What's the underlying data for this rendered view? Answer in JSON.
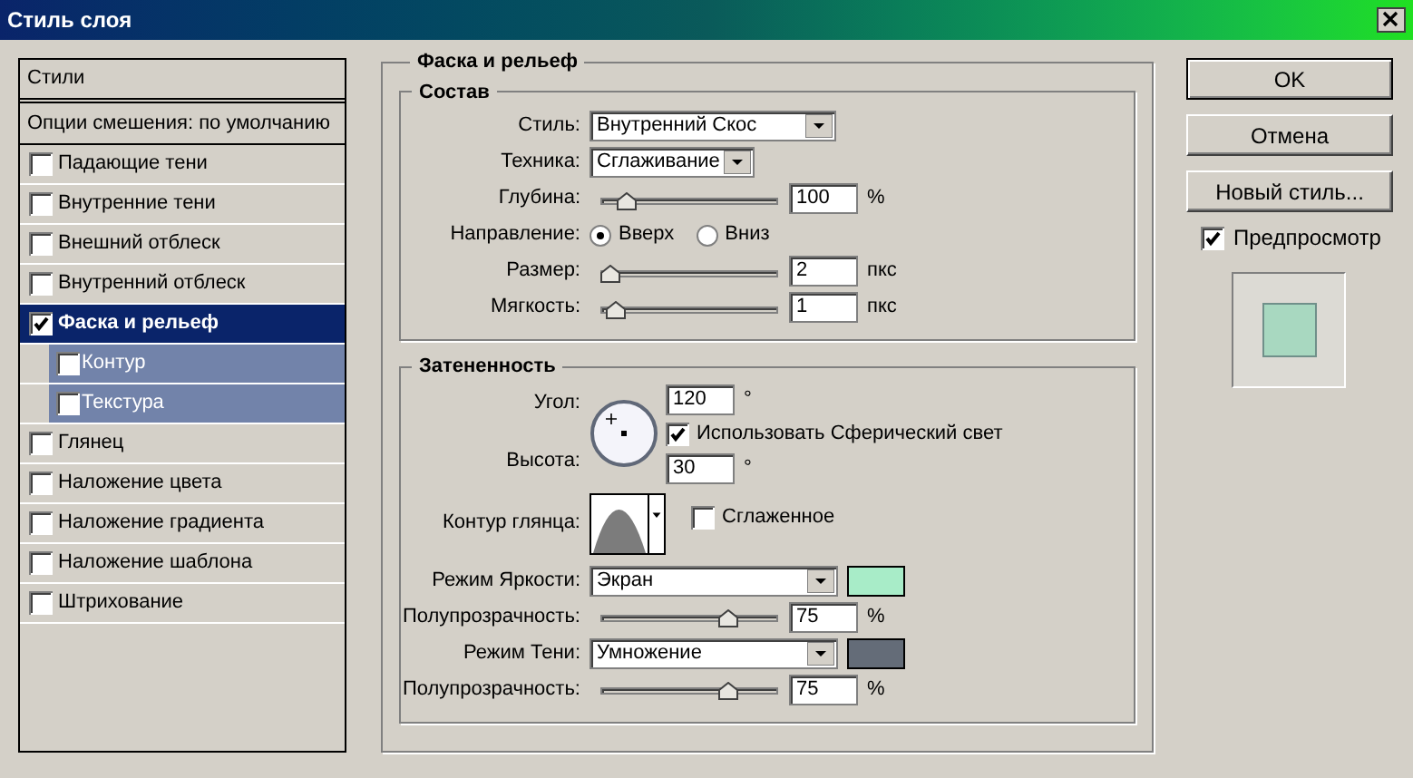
{
  "window": {
    "title": "Стиль слоя"
  },
  "sidebar": {
    "header": "Стили",
    "blending": "Опции смешения: по умолчанию",
    "items": [
      {
        "label": "Падающие тени",
        "checked": false,
        "selected": false
      },
      {
        "label": "Внутренние тени",
        "checked": false,
        "selected": false
      },
      {
        "label": "Внешний отблеск",
        "checked": false,
        "selected": false
      },
      {
        "label": "Внутренний отблеск",
        "checked": false,
        "selected": false
      },
      {
        "label": "Фаска и рельеф",
        "checked": true,
        "selected": true,
        "children": [
          {
            "label": "Контур",
            "checked": false
          },
          {
            "label": "Текстура",
            "checked": false
          }
        ]
      },
      {
        "label": "Глянец",
        "checked": false,
        "selected": false
      },
      {
        "label": "Наложение цвета",
        "checked": false,
        "selected": false
      },
      {
        "label": "Наложение градиента",
        "checked": false,
        "selected": false
      },
      {
        "label": "Наложение шаблона",
        "checked": false,
        "selected": false
      },
      {
        "label": "Штрихование",
        "checked": false,
        "selected": false
      }
    ]
  },
  "panel": {
    "title": "Фаска и рельеф",
    "structure": {
      "title": "Состав",
      "rows": [
        {
          "kind": "select",
          "label": "Стиль:",
          "value": "Внутренний Скос"
        },
        {
          "kind": "select",
          "label": "Техника:",
          "value": "Сглаживание"
        },
        {
          "kind": "slider",
          "label": "Глубина:",
          "level": 0.1,
          "value": "100",
          "unit": "%"
        },
        {
          "kind": "radio",
          "label": "Направление:",
          "options": [
            {
              "label": "Вверх",
              "selected": true
            },
            {
              "label": "Вниз",
              "selected": false
            }
          ]
        },
        {
          "kind": "slider",
          "label": "Размер:",
          "level": 0.0,
          "value": "2",
          "unit": "пкс"
        },
        {
          "kind": "slider",
          "label": "Мягкость:",
          "level": 0.04,
          "value": "1",
          "unit": "пкс"
        }
      ]
    },
    "shading": {
      "title": "Затененность",
      "angle": {
        "label": "Угол:",
        "value": "120",
        "unit": "°"
      },
      "global_light": {
        "label": "Использовать Сферический свет",
        "checked": true
      },
      "altitude": {
        "label": "Высота:",
        "value": "30",
        "unit": "°"
      },
      "gloss_contour": {
        "label": "Контур глянца:"
      },
      "anti_aliased": {
        "label": "Сглаженное",
        "checked": false
      },
      "rows": [
        {
          "kind": "select",
          "label": "Режим Яркости:",
          "value": "Экран",
          "color": "#a8ecc8"
        },
        {
          "kind": "slider",
          "label": "Полупрозрачность:",
          "level": 0.75,
          "value": "75",
          "unit": "%"
        },
        {
          "kind": "select",
          "label": "Режим Тени:",
          "value": "Умножение",
          "color": "#646c78"
        },
        {
          "kind": "slider",
          "label": "Полупрозрачность:",
          "level": 0.75,
          "value": "75",
          "unit": "%"
        }
      ]
    }
  },
  "buttons": [
    {
      "label": "OK",
      "default": true
    },
    {
      "label": "Отмена",
      "default": false
    },
    {
      "label": "Новый стиль...",
      "default": false
    }
  ],
  "preview": {
    "label": "Предпросмотр",
    "checked": true
  }
}
